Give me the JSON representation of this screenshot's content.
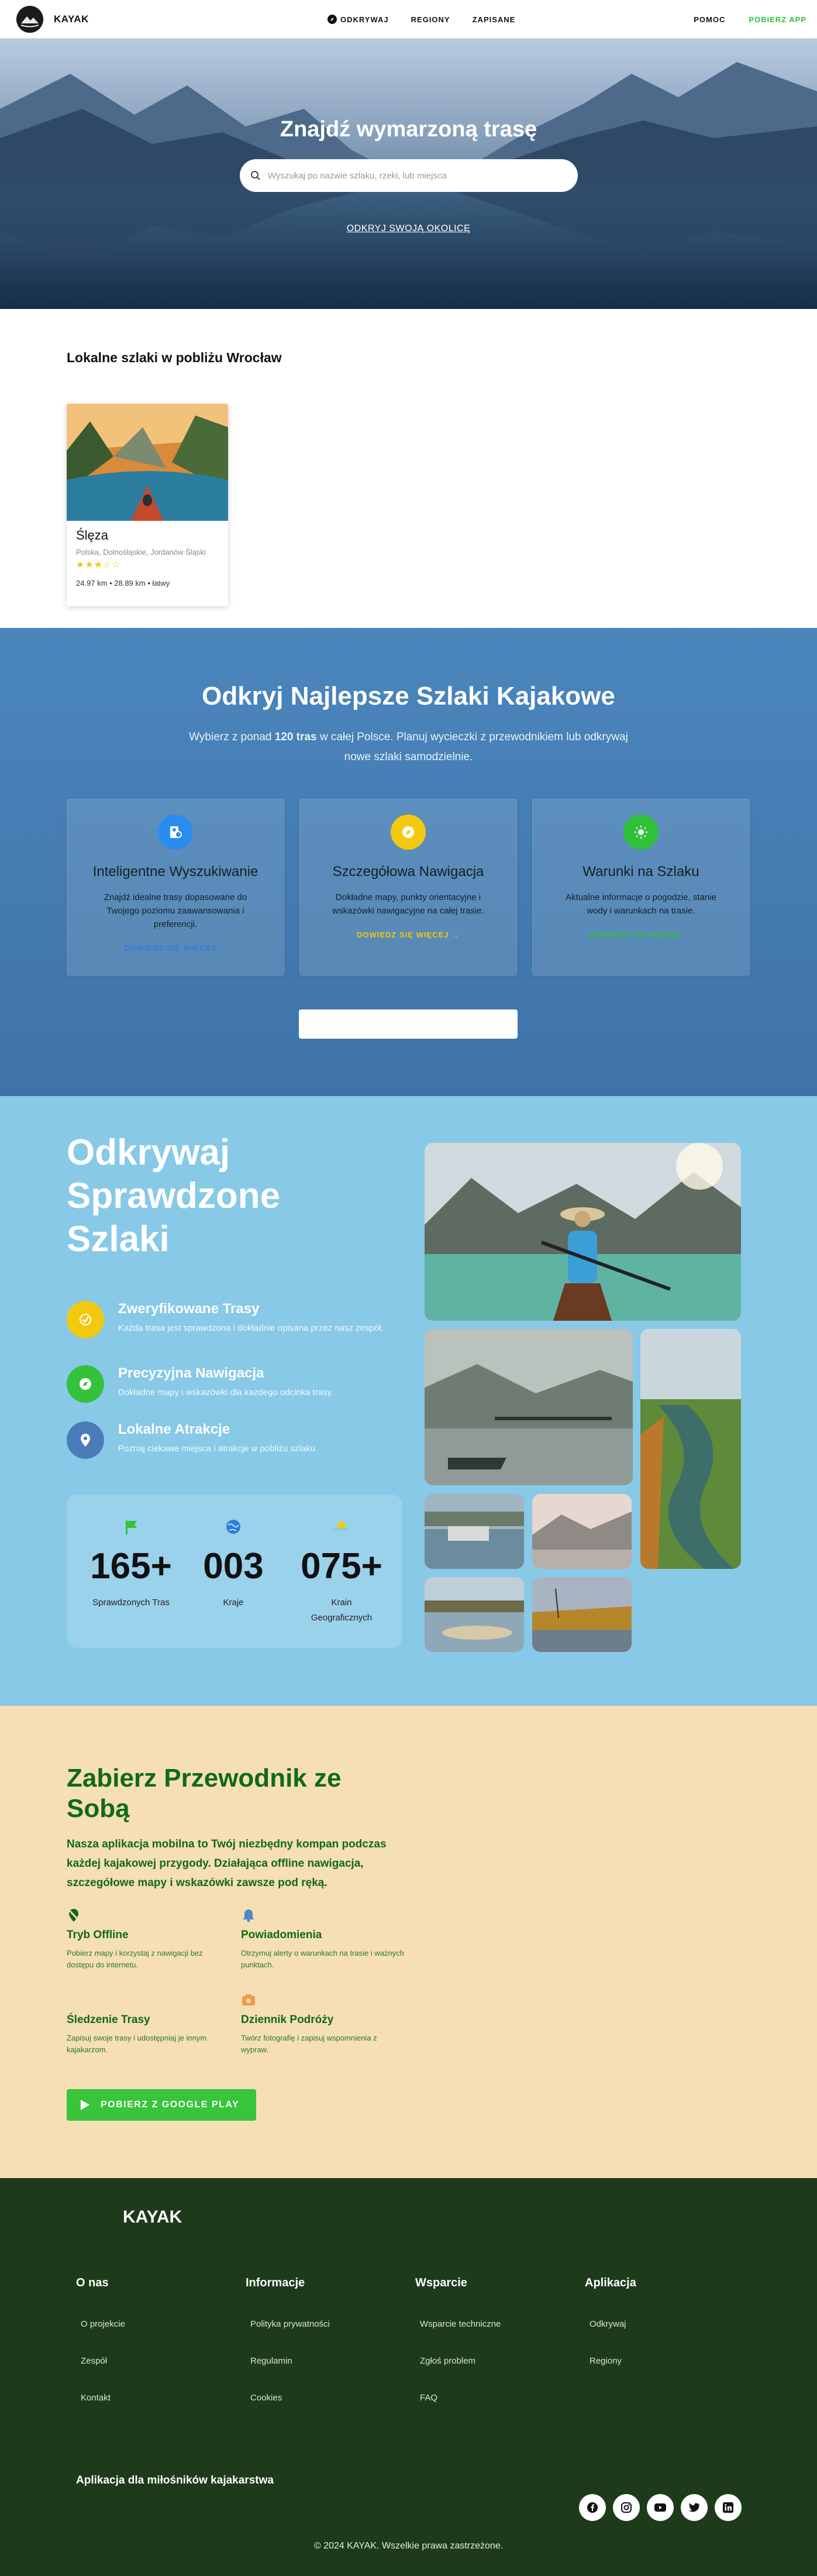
{
  "nav": {
    "brand": "KAYAK",
    "links": [
      "ODKRYWAJ",
      "REGIONY",
      "ZAPISANE"
    ],
    "help": "POMOC",
    "get_app": "POBIERZ APP"
  },
  "hero": {
    "title": "Znajdź wymarzoną trasę",
    "search_placeholder": "Wyszukaj po nazwie szlaku, rzeki, lub miejsca",
    "link": "ODKRYJ SWOJĄ OKOLICĘ"
  },
  "local": {
    "title": "Lokalne szlaki w pobliżu Wrocław",
    "card": {
      "name": "Ślęza",
      "region": "Polska, Dolnośląskie, Jordanów Śląski",
      "stars": "★★★☆☆",
      "stats": "24.97 km • 28.89 km • łatwy"
    }
  },
  "discover": {
    "title": "Odkryj Najlepsze Szlaki Kajakowe",
    "sub_pre": "Wybierz z ponad ",
    "sub_bold": "120 tras",
    "sub_post": " w całej Polsce. Planuj wycieczki z przewodnikiem lub odkrywaj nowe szlaki samodzielnie.",
    "features": [
      {
        "title": "Inteligentne Wyszukiwanie",
        "desc": "Znajdź idealne trasy dopasowane do Twojego poziomu zaawansowania i preferencji.",
        "link": "DOWIEDZ SIĘ WIĘCEJ →",
        "color": "#2a8cf0",
        "link_color": "#2a7de0"
      },
      {
        "title": "Szczegółowa Nawigacja",
        "desc": "Dokładne mapy, punkty orientacyjne i wskazówki nawigacyjne na całej trasie.",
        "link": "DOWIEDZ SIĘ WIĘCEJ →",
        "color": "#f2c90c",
        "link_color": "#f2c90c"
      },
      {
        "title": "Warunki na Szlaku",
        "desc": "Aktualne informacje o pogodzie, stanie wody i warunkach na trasie.",
        "link": "DOWIEDZ SIĘ WIĘCEJ →",
        "color": "#2fc13a",
        "link_color": "#2fc13a"
      }
    ]
  },
  "verified": {
    "title_lines": [
      "Odkrywaj",
      "Sprawdzone",
      "Szlaki"
    ],
    "items": [
      {
        "title": "Zweryfikowane Trasy",
        "desc": "Każda trasa jest sprawdzona i dokładnie opisana przez nasz zespół.",
        "color": "#f2c90c"
      },
      {
        "title": "Precyzyjna Nawigacja",
        "desc": "Dokładne mapy i wskazówki dla każdego odcinka trasy.",
        "color": "#33c23b"
      },
      {
        "title": "Lokalne Atrakcje",
        "desc": "Poznaj ciekawe miejsca i atrakcje w pobliżu szlaku.",
        "color": "#4a7db8"
      }
    ],
    "stats": [
      {
        "num": "165",
        "label": "Sprawdzonych Tras"
      },
      {
        "num": "003",
        "label": "Kraje"
      },
      {
        "num": "075",
        "label": "Krain Geograficznych"
      }
    ],
    "plus": "+"
  },
  "app": {
    "title": "Zabierz Przewodnik ze Sobą",
    "desc": "Nasza aplikacja mobilna to Twój niezbędny kompan podczas każdej kajakowej przygody. Działająca offline nawigacja, szczegółowe mapy i wskazówki zawsze pod ręką.",
    "features": [
      {
        "title": "Tryb Offline",
        "desc": "Pobierz mapy i korzystaj z nawigacji bez dostępu do internetu."
      },
      {
        "title": "Powiadomienia",
        "desc": "Otrzymuj alerty o warunkach na trasie i ważnych punktach."
      },
      {
        "title": "Śledzenie Trasy",
        "desc": "Zapisuj swoje trasy i udostępniaj je innym kajakarzom."
      },
      {
        "title": "Dziennik Podróży",
        "desc": "Twórz fotografię i zapisuj wspomnienia z wypraw."
      }
    ],
    "button": "POBIERZ Z GOOGLE PLAY"
  },
  "footer": {
    "brand": "KAYAK",
    "columns": [
      {
        "heading": "O nas",
        "links": [
          "O projekcie",
          "Zespół",
          "Kontakt"
        ]
      },
      {
        "heading": "Informacje",
        "links": [
          "Polityka prywatności",
          "Regulamin",
          "Cookies"
        ]
      },
      {
        "heading": "Wsparcie",
        "links": [
          "Wsparcie techniczne",
          "Zgłoś problem",
          "FAQ"
        ]
      },
      {
        "heading": "Aplikacja",
        "links": [
          "Odkrywaj",
          "Regiony"
        ]
      }
    ],
    "tagline": "Aplikacja dla miłośników kajakarstwa",
    "copyright": "© 2024 KAYAK. Wszelkie prawa zastrzeżone.",
    "socials": [
      "facebook-icon",
      "instagram-icon",
      "youtube-icon",
      "twitter-icon",
      "linkedin-icon"
    ]
  }
}
